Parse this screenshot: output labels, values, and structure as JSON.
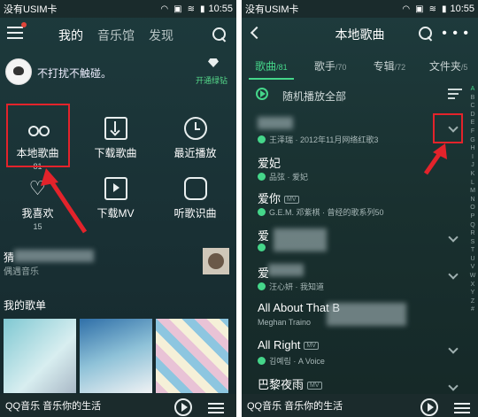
{
  "left": {
    "status": {
      "carrier": "没有USIM卡",
      "time": "10:55"
    },
    "tabs": [
      "我的",
      "音乐馆",
      "发现"
    ],
    "profile": {
      "nickname": "不打扰不触碰。",
      "vip_label": "开通绿钻"
    },
    "grid": [
      {
        "label": "本地歌曲",
        "count": "81",
        "icon": "music-note-icon"
      },
      {
        "label": "下载歌曲",
        "count": "",
        "icon": "download-icon"
      },
      {
        "label": "最近播放",
        "count": "",
        "icon": "clock-icon"
      },
      {
        "label": "我喜欢",
        "count": "15",
        "icon": "heart-icon"
      },
      {
        "label": "下载MV",
        "count": "",
        "icon": "mv-icon"
      },
      {
        "label": "听歌识曲",
        "count": "",
        "icon": "mic-icon"
      }
    ],
    "recent": {
      "title": "猜",
      "subtitle": "偶遇音乐"
    },
    "playlists_title": "我的歌单",
    "bottom_text": "QQ音乐 音乐你的生活"
  },
  "right": {
    "title": "本地歌曲",
    "tabs": [
      {
        "label": "歌曲",
        "count": "/81"
      },
      {
        "label": "歌手",
        "count": "/70"
      },
      {
        "label": "专辑",
        "count": "/72"
      },
      {
        "label": "文件夹",
        "count": "/5"
      }
    ],
    "play_all": "随机播放全部",
    "songs": [
      {
        "name": "",
        "meta": "王泽瑞 · 2012年11月网络红歌3",
        "mv": false
      },
      {
        "name": "爱妃",
        "meta": "品弦 · 爱妃",
        "mv": false
      },
      {
        "name": "爱你",
        "meta": "G.E.M. 邓紫棋 · 曾经的歌系列50",
        "mv": true
      },
      {
        "name": "爱",
        "meta": "",
        "mv": false
      },
      {
        "name": "爱",
        "meta": "汪心妍 · 我知道",
        "mv": false
      },
      {
        "name": "All About That B",
        "meta": "Meghan Traino",
        "mv": false
      },
      {
        "name": "All Right",
        "meta": "김예림 · A Voice",
        "mv": true
      },
      {
        "name": "巴黎夜雨",
        "meta": "",
        "mv": true
      }
    ],
    "mv_badge": "MV",
    "alphabet": [
      "A",
      "B",
      "C",
      "D",
      "E",
      "F",
      "G",
      "H",
      "I",
      "J",
      "K",
      "L",
      "M",
      "N",
      "O",
      "P",
      "Q",
      "R",
      "S",
      "T",
      "U",
      "V",
      "W",
      "X",
      "Y",
      "Z",
      "#"
    ],
    "bottom_text": "QQ音乐 音乐你的生活"
  },
  "colors": {
    "accent": "#45d68a",
    "highlight": "#e3232b"
  }
}
